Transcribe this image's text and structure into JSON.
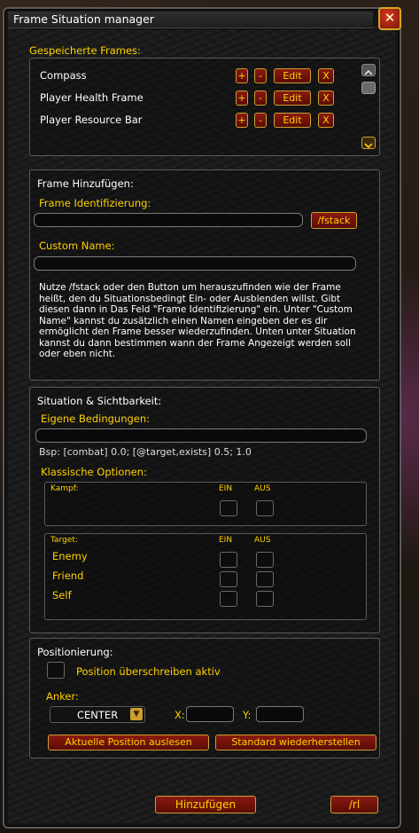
{
  "window": {
    "title": "Frame Situation manager",
    "close_glyph": "✕"
  },
  "saved": {
    "heading": "Gespeicherte Frames:",
    "frames": [
      {
        "name": "Compass"
      },
      {
        "name": "Player Health Frame"
      },
      {
        "name": "Player Resource Bar"
      }
    ],
    "plus": "+",
    "minus": "-",
    "edit": "Edit",
    "delete": "X"
  },
  "add": {
    "heading": "Frame Hinzufügen:",
    "id_label": "Frame Identifizierung:",
    "id_value": "",
    "fstack_button": "/fstack",
    "custom_label": "Custom Name:",
    "custom_value": "",
    "help": "Nutze /fstack oder den Button um herauszufinden wie der Frame heißt, den du Situationsbedingt Ein- oder Ausblenden willst. Gibt diesen dann in Das Feld \"Frame Identifizierung\" ein. Unter \"Custom Name\" kannst du zusätzlich einen Namen eingeben der es dir ermöglicht den Frame besser wiederzufinden. Unten unter Situation kannst du dann bestimmen wann der Frame Angezeigt werden soll oder eben nicht."
  },
  "situation": {
    "heading": "Situation & Sichtbarkeit:",
    "own_label": "Eigene Bedingungen:",
    "own_value": "",
    "example": "Bsp: [combat] 0.0; [@target,exists] 0.5; 1.0",
    "classic_label": "Klassische Optionen:",
    "on": "EIN",
    "off": "AUS",
    "combat": {
      "label": "Kampf:"
    },
    "target": {
      "label": "Target:",
      "rows": [
        {
          "label": "Enemy"
        },
        {
          "label": "Friend"
        },
        {
          "label": "Self"
        }
      ]
    }
  },
  "position": {
    "heading": "Positionierung:",
    "override_label": "Position überschreiben aktiv",
    "anchor_label": "Anker:",
    "anchor_value": "CENTER",
    "x_label": "X:",
    "x_value": "",
    "y_label": "Y:",
    "y_value": "",
    "read_button": "Aktuelle Position auslesen",
    "reset_button": "Standard wiederherstellen"
  },
  "footer": {
    "add_button": "Hinzufügen",
    "reload_button": "/rl"
  },
  "colors": {
    "gold": "#ffd100",
    "button_red": "#8a1a10",
    "border": "#c9a030"
  }
}
